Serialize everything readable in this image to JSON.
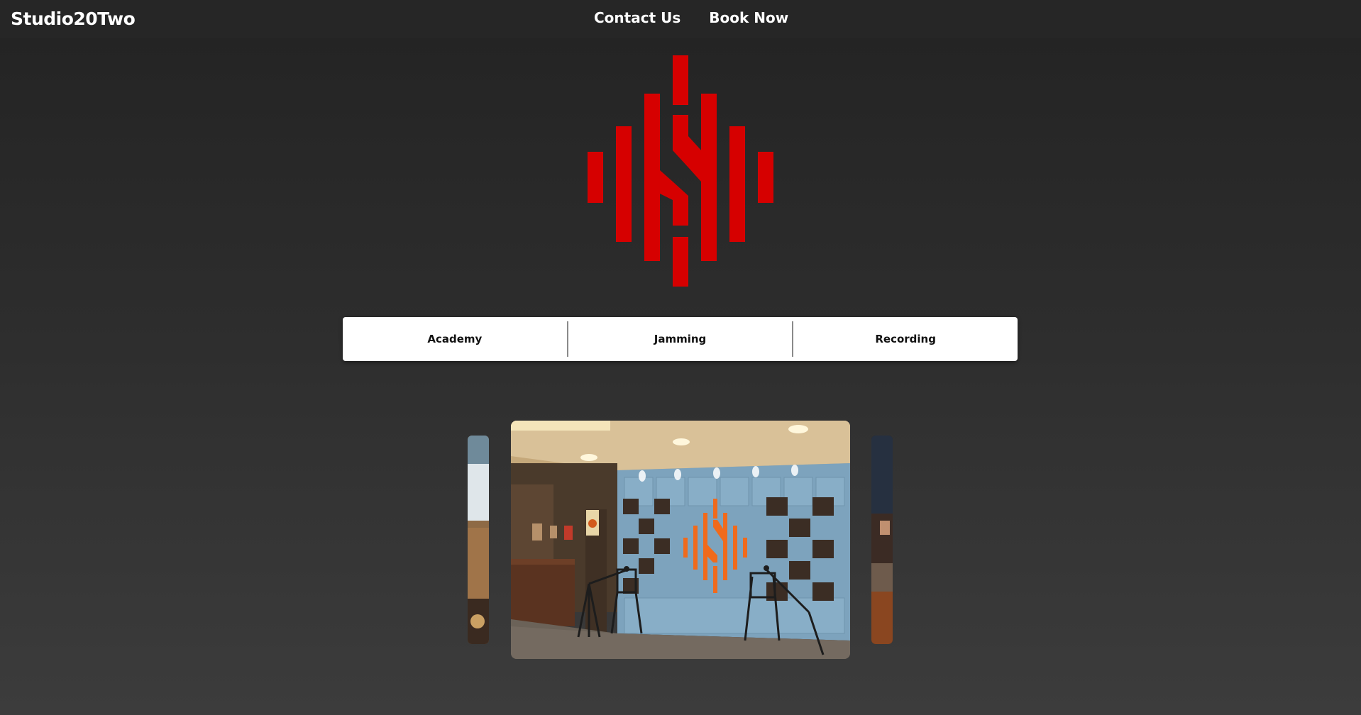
{
  "header": {
    "brand": "Studio20Two",
    "nav": [
      {
        "label": "Contact Us"
      },
      {
        "label": "Book Now"
      }
    ]
  },
  "logo": {
    "icon": "studio-logo-icon",
    "color": "#d60000"
  },
  "tabs": [
    {
      "label": "Academy"
    },
    {
      "label": "Jamming"
    },
    {
      "label": "Recording"
    }
  ],
  "carousel": {
    "slides": [
      {
        "icon": "studio-photo-prev"
      },
      {
        "icon": "studio-room-photo"
      },
      {
        "icon": "studio-photo-next"
      }
    ],
    "accent_colors": {
      "wall": "#7da3bd",
      "logo_panels": "#f06a1c",
      "foam": "#3b2d24"
    }
  }
}
